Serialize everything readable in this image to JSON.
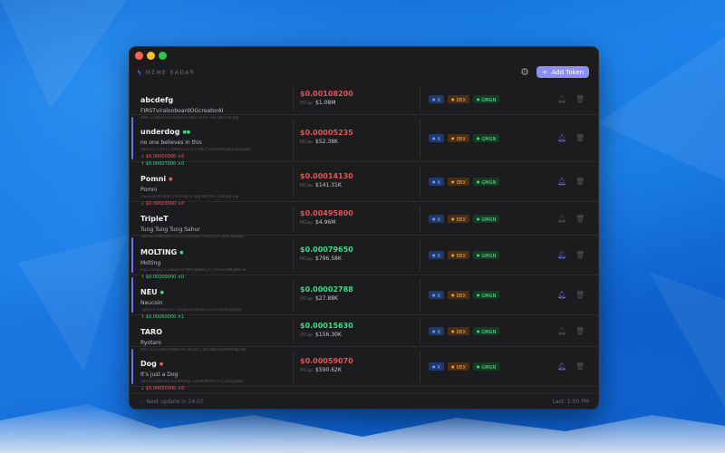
{
  "app": {
    "logo_text": "MEME RADAR",
    "add_button_label": "Add Token"
  },
  "tokens": [
    {
      "symbol": "abcdefg",
      "dots": "",
      "dot_color": "",
      "name": "FIRSTviralonboardOGcreatorAI",
      "address": "8XKFvn8khosDcbUHzhmzaR1sd1tFnd2j8eY3pump",
      "change_down": "",
      "change_up": "",
      "price": "$0.00108200",
      "price_color": "red",
      "mcap_label": "MCap",
      "mcap": "$1.08M",
      "bell": false,
      "active": false
    },
    {
      "symbol": "underdog",
      "dots": "●●",
      "dot_color": "green",
      "name": "no one believes in this",
      "address": "9badus2fnsfTJPD6suJS7CFCNGfSxA1bbaGNqzZRdpump",
      "change_down": "↓ $0.00000000 ×0",
      "change_up": "↑ $0.00007000 ×0",
      "price": "$0.00005235",
      "price_color": "red",
      "mcap_label": "MCap",
      "mcap": "$52.38K",
      "bell": true,
      "active": true
    },
    {
      "symbol": "Pomni",
      "dots": "●",
      "dot_color": "red",
      "name": "Pomni",
      "address": "2SEeuUsXfbpdrjMioagtvFWgcWkfMXlzz8nkpump",
      "change_down": "↓ $0.00003000 ×0",
      "change_up": "",
      "price": "$0.00014130",
      "price_color": "red",
      "mcap_label": "MCap",
      "mcap": "$141.31K",
      "bell": true,
      "active": false
    },
    {
      "symbol": "TripleT",
      "dots": "",
      "dot_color": "",
      "name": "Tung Tung Tung Sahur",
      "address": "3WF6VEVBWob0zz1Z12tZKHuqrYhcyjnX7gbV2Kpump",
      "change_down": "",
      "change_up": "",
      "price": "$0.00495800",
      "price_color": "red",
      "mcap_label": "MCap",
      "mcap": "$4.96M",
      "bell": false,
      "active": false
    },
    {
      "symbol": "MOLTING",
      "dots": "●",
      "dot_color": "green",
      "name": "Molting",
      "address": "8SEsnXq4yzs3Hbnz1RYMhnQ8WejZC7Yb3waJMHgMeuS",
      "change_down": "",
      "change_up": "↑ $0.00200000 ×0",
      "price": "$0.00079650",
      "price_color": "green",
      "mcap_label": "MCap",
      "mcap": "$796.58K",
      "bell": true,
      "active": true
    },
    {
      "symbol": "NEU",
      "dots": "●",
      "dot_color": "green",
      "name": "Neucoin",
      "address": "7qmhcb7ufbVuhrl1xg6xGnHe4ki1a7z5bnXS2pump",
      "change_down": "",
      "change_up": "↑ $0.00060000 ×1",
      "price": "$0.00002788",
      "price_color": "green",
      "mcap_label": "MCap",
      "mcap": "$27.88K",
      "bell": true,
      "active": true
    },
    {
      "symbol": "TARO",
      "dots": "",
      "dot_color": "",
      "name": "Ryotaro",
      "address": "8MF1zsx2uMJekMeno8c3b1hFj38YeMDz2pmtMkMpump",
      "change_down": "",
      "change_up": "",
      "price": "$0.00015630",
      "price_color": "green",
      "mcap_label": "MCap",
      "mcap": "$156.30K",
      "bell": false,
      "active": false
    },
    {
      "symbol": "Dog",
      "dots": "●",
      "dot_color": "red",
      "name": "It's just a Dog",
      "address": "5Dxbu2bWd1K9ZDJbMQDgF1vkHbMWf8r41j5h2Gpump",
      "change_down": "↓ $0.00050000 ×0",
      "change_up": "",
      "price": "$0.00059070",
      "price_color": "red",
      "mcap_label": "MCap",
      "mcap": "$590.62K",
      "bell": true,
      "active": true
    }
  ],
  "badge_labels": {
    "x": "X",
    "dex": "DEX",
    "gmgn": "GMGN"
  },
  "footer": {
    "next_update": "Next update in 24:07",
    "last": "Last: 1:00 PM"
  },
  "colors": {
    "accent": "#8b8ef2",
    "up": "#3ddc84",
    "down": "#e05555"
  },
  "icons": {
    "logo": "lightning-icon",
    "settings": "gear-icon",
    "add": "plus-icon",
    "bell": "bell-icon",
    "trash": "trash-icon"
  }
}
